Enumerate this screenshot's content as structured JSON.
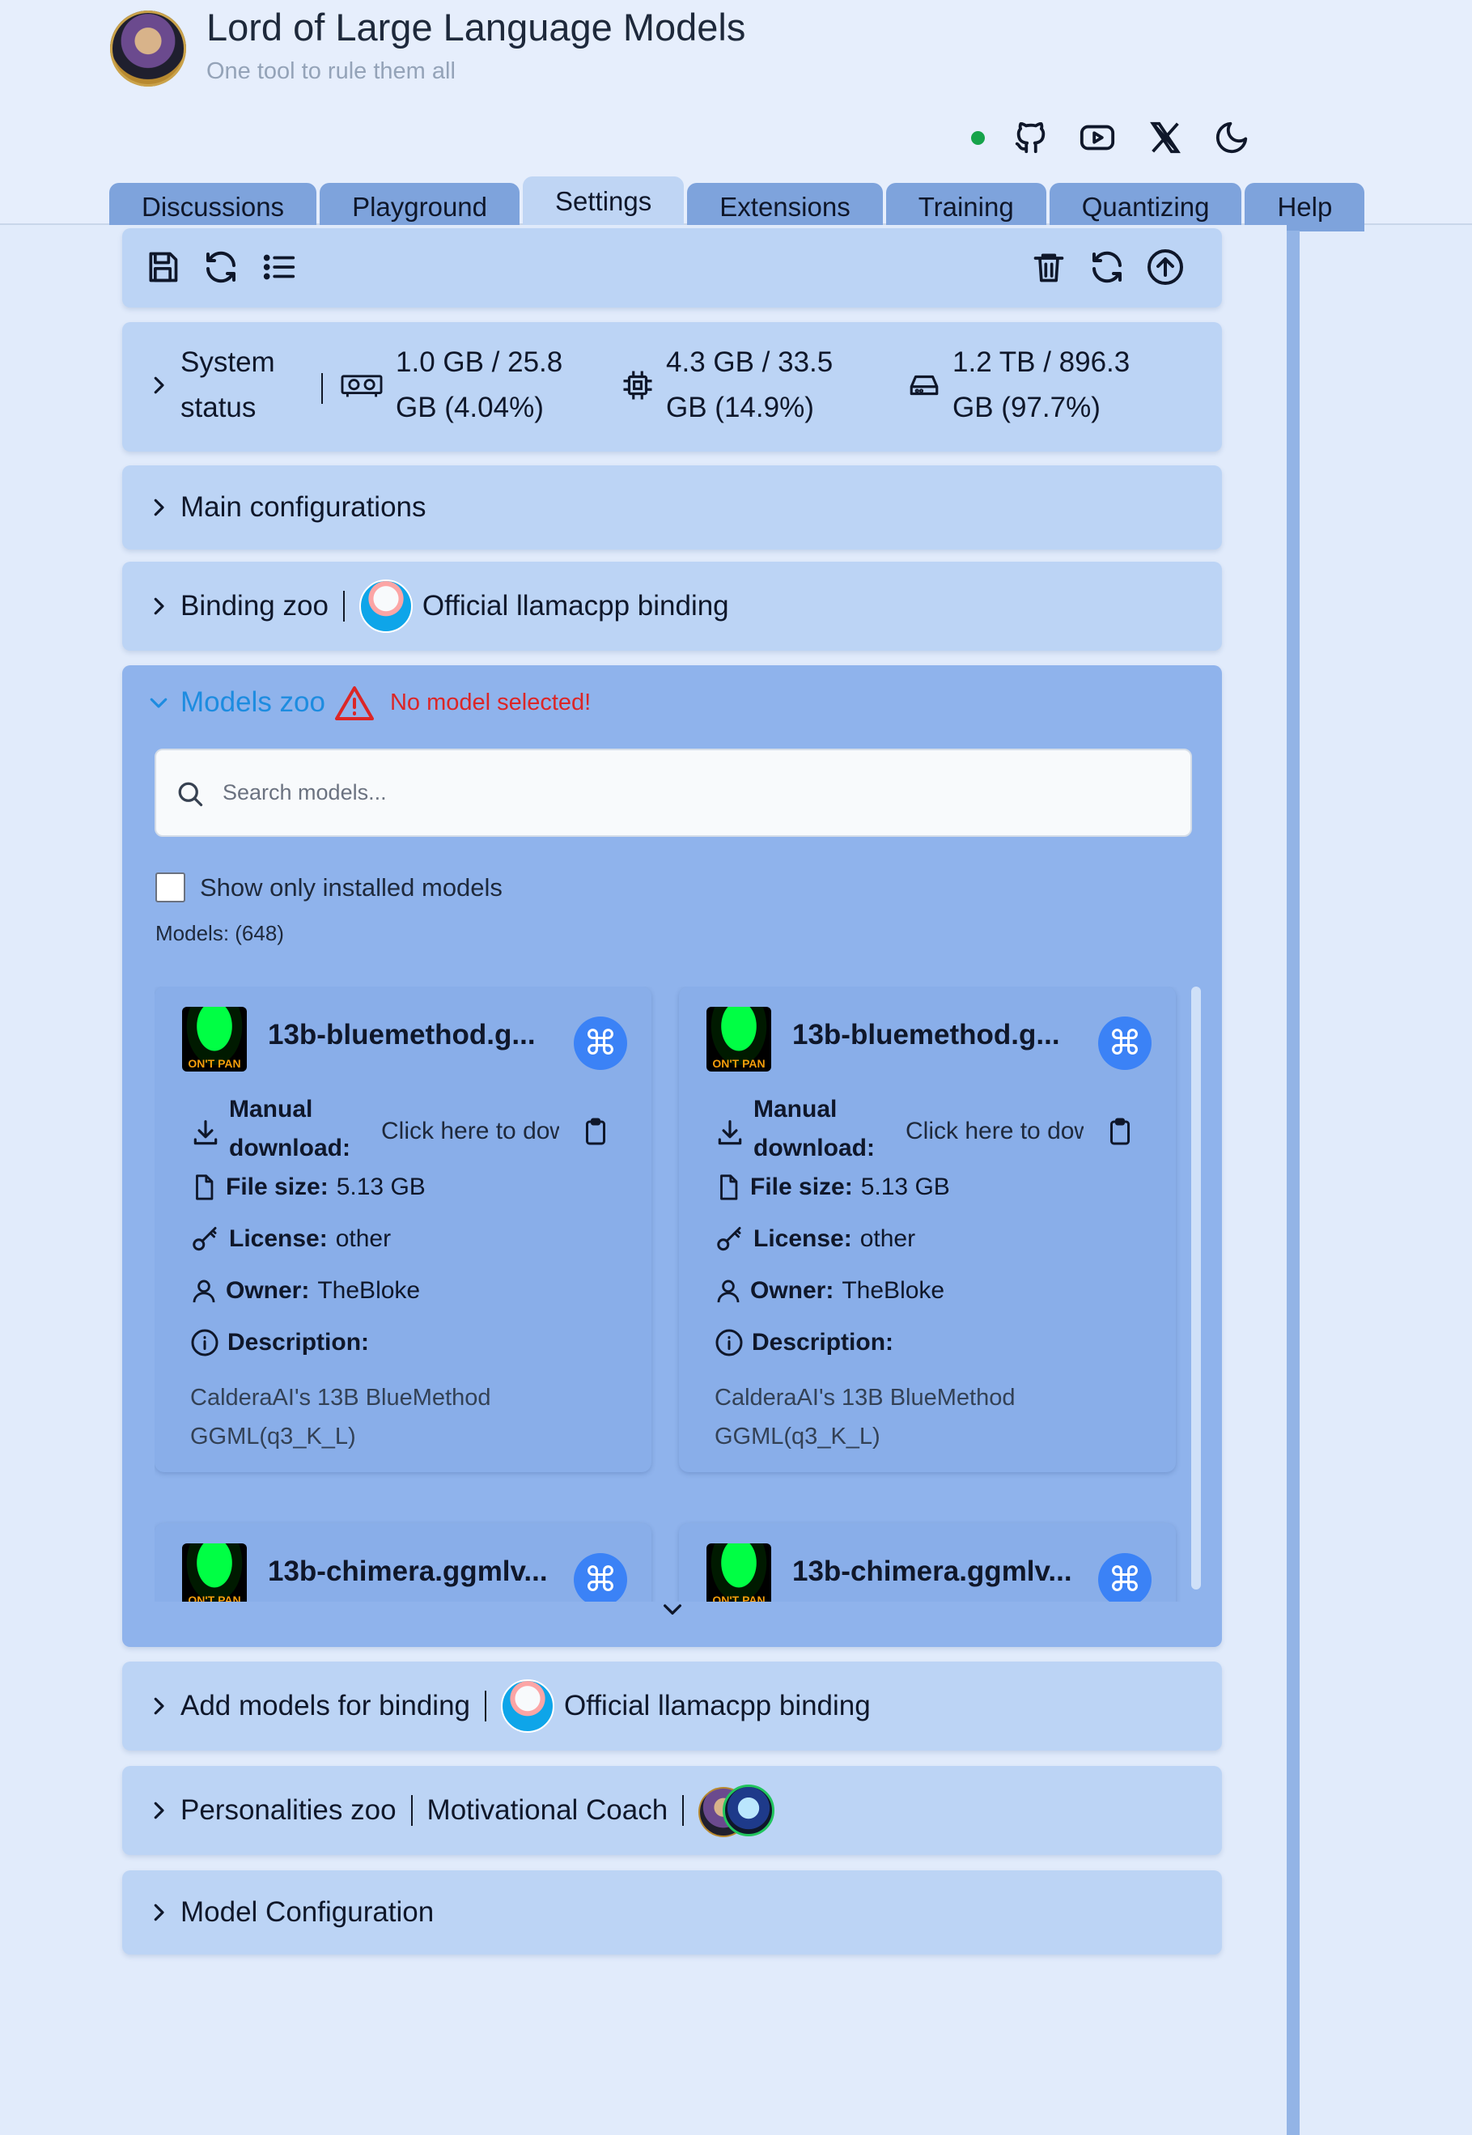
{
  "app": {
    "title": "Lord of Large Language Models",
    "subtitle": "One tool to rule them all"
  },
  "header_icons": [
    "status-dot",
    "github-icon",
    "youtube-icon",
    "x-icon",
    "moon-icon"
  ],
  "tabs": [
    "Discussions",
    "Playground",
    "Settings",
    "Extensions",
    "Training",
    "Quantizing",
    "Help"
  ],
  "active_tab": "Settings",
  "system_status": {
    "label": "System status",
    "vram": "1.0 GB / 25.8 GB (4.04%)",
    "ram": "4.3 GB / 33.5 GB (14.9%)",
    "disk": "1.2 TB / 896.3 GB (97.7%)"
  },
  "sections": {
    "main_config": "Main configurations",
    "binding_zoo": "Binding zoo",
    "binding_name": "Official llamacpp binding",
    "models_zoo": "Models zoo",
    "no_model_warning": "No model selected!",
    "add_models": "Add models for binding",
    "personalities_zoo": "Personalities zoo",
    "personality_name": "Motivational Coach",
    "model_config": "Model Configuration"
  },
  "models_zoo": {
    "search_placeholder": "Search models...",
    "show_installed_label": "Show only installed models",
    "count_label": "Models: (648)",
    "cards": [
      {
        "name": "13b-bluemethod.g...",
        "manual_download_label": "Manual download:",
        "manual_download_link": "Click here to download",
        "file_size_label": "File size:",
        "file_size": "5.13 GB",
        "license_label": "License:",
        "license": "other",
        "owner_label": "Owner:",
        "owner": "TheBloke",
        "description_label": "Description:",
        "description": "CalderaAI's 13B BlueMethod GGML(q3_K_L)"
      },
      {
        "name": "13b-bluemethod.g...",
        "manual_download_label": "Manual download:",
        "manual_download_link": "Click here to download",
        "file_size_label": "File size:",
        "file_size": "5.13 GB",
        "license_label": "License:",
        "license": "other",
        "owner_label": "Owner:",
        "owner": "TheBloke",
        "description_label": "Description:",
        "description": "CalderaAI's 13B BlueMethod GGML(q3_K_L)"
      },
      {
        "name": "13b-chimera.ggmlv..."
      },
      {
        "name": "13b-chimera.ggmlv..."
      }
    ]
  }
}
